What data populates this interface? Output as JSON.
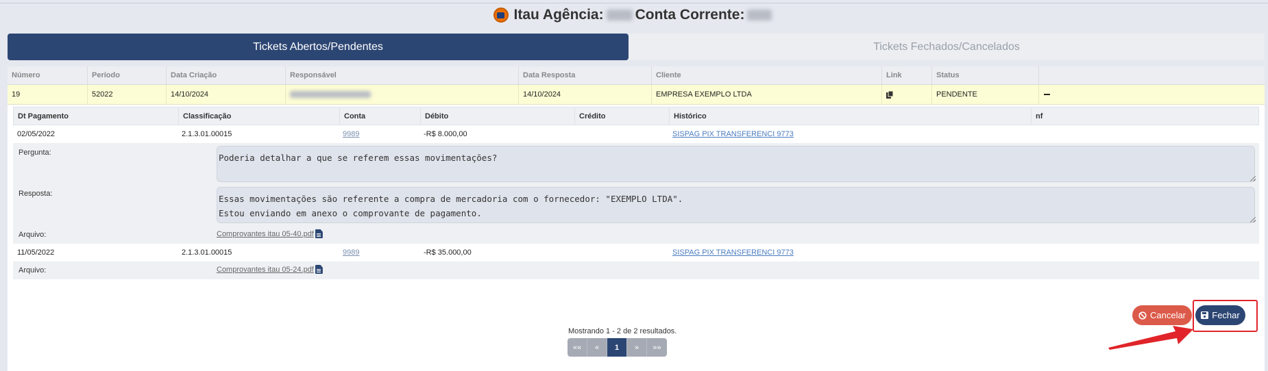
{
  "header": {
    "agencia_label": "Itau Agência:",
    "conta_label": "Conta Corrente:"
  },
  "tabs": [
    {
      "label": "Tickets Abertos/Pendentes",
      "active": true
    },
    {
      "label": "Tickets Fechados/Cancelados",
      "active": false
    }
  ],
  "tickets": {
    "columns": [
      "Número",
      "Período",
      "Data Criação",
      "Responsável",
      "Data Resposta",
      "Cliente",
      "Link",
      "Status"
    ],
    "row": {
      "numero": "19",
      "periodo": "52022",
      "data_criacao": "14/10/2024",
      "data_resposta": "14/10/2024",
      "cliente": "EMPRESA EXEMPLO LTDA",
      "status": "PENDENTE"
    }
  },
  "detail": {
    "columns": [
      "Dt Pagamento",
      "Classificação",
      "Conta",
      "Débito",
      "Crédito",
      "Histórico",
      "nf"
    ],
    "pergunta_label": "Pergunta:",
    "resposta_label": "Resposta:",
    "arquivo_label": "Arquivo:",
    "entries": [
      {
        "dt_pagamento": "02/05/2022",
        "classificacao": "2.1.3.01.00015",
        "conta": "9989",
        "debito": "-R$ 8.000,00",
        "credito": "",
        "historico": "SISPAG PIX TRANSFERENCI 9773",
        "pergunta": "Poderia detalhar a que se referem essas movimentações?",
        "resposta": "Essas movimentações são referente a compra de mercadoria com o fornecedor: \"EXEMPLO LTDA\".\nEstou enviando em anexo o comprovante de pagamento.",
        "arquivo": "Comprovantes itau 05-40.pdf"
      },
      {
        "dt_pagamento": "11/05/2022",
        "classificacao": "2.1.3.01.00015",
        "conta": "9989",
        "debito": "-R$ 35.000,00",
        "credito": "",
        "historico": "SISPAG PIX TRANSFERENCI 9773",
        "arquivo": "Comprovantes itau 05-24.pdf"
      }
    ]
  },
  "actions": {
    "cancel_label": "Cancelar",
    "close_label": "Fechar"
  },
  "pagination": {
    "showing": "Mostrando 1 - 2 de 2 resultados.",
    "first": "««",
    "prev": "«",
    "current": "1",
    "next": "»",
    "last": "»»"
  },
  "colors": {
    "primary": "#2c4673",
    "danger": "#dc5a49",
    "highlight": "#e0242a",
    "pending_row": "#fdfdd5"
  }
}
